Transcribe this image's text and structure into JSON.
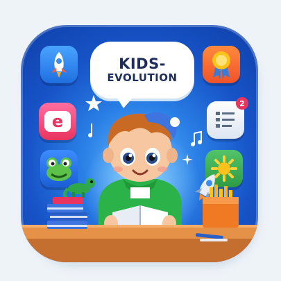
{
  "title": {
    "line1": "KIDS-",
    "line2": "EVOLUTION"
  },
  "tiles": {
    "left": [
      "rocket-icon",
      "letter-e-icon",
      "frog-icon"
    ],
    "right": [
      "award-ribbon-icon",
      "checklist-icon",
      "sun-icon"
    ]
  },
  "notification_badge": "2",
  "tile_letter": "e",
  "colors": {
    "background": "#eef3f8",
    "icon_blue": "#1754c8",
    "bubble": "#ffffff",
    "title_text": "#1f2d5a",
    "hoodie_green": "#2bb34a",
    "shelf_orange": "#e59148"
  }
}
